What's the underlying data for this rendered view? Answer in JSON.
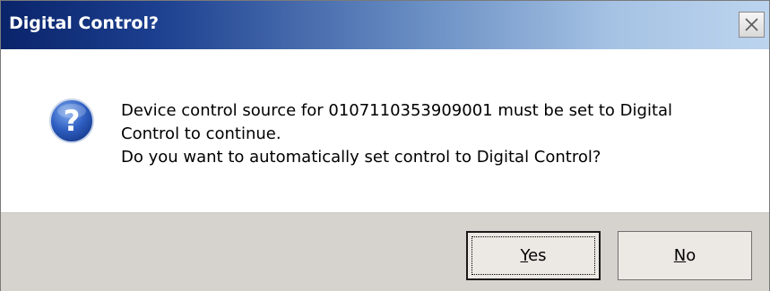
{
  "window": {
    "title": "Digital Control?",
    "close_icon": "close-icon"
  },
  "message": {
    "icon": "question-icon",
    "lines": [
      "Device control source for 0107110353909001 must be set to Digital",
      "Control to continue.",
      "Do you want to automatically set control to Digital Control?"
    ]
  },
  "buttons": {
    "yes": {
      "mnemonic": "Y",
      "rest": "es"
    },
    "no": {
      "mnemonic": "N",
      "rest": "o"
    }
  },
  "colors": {
    "title_gradient_start": "#0a246a",
    "title_gradient_end": "#bcd4ee",
    "button_bar": "#d6d3ce",
    "icon_blue": "#2f5fc2"
  }
}
